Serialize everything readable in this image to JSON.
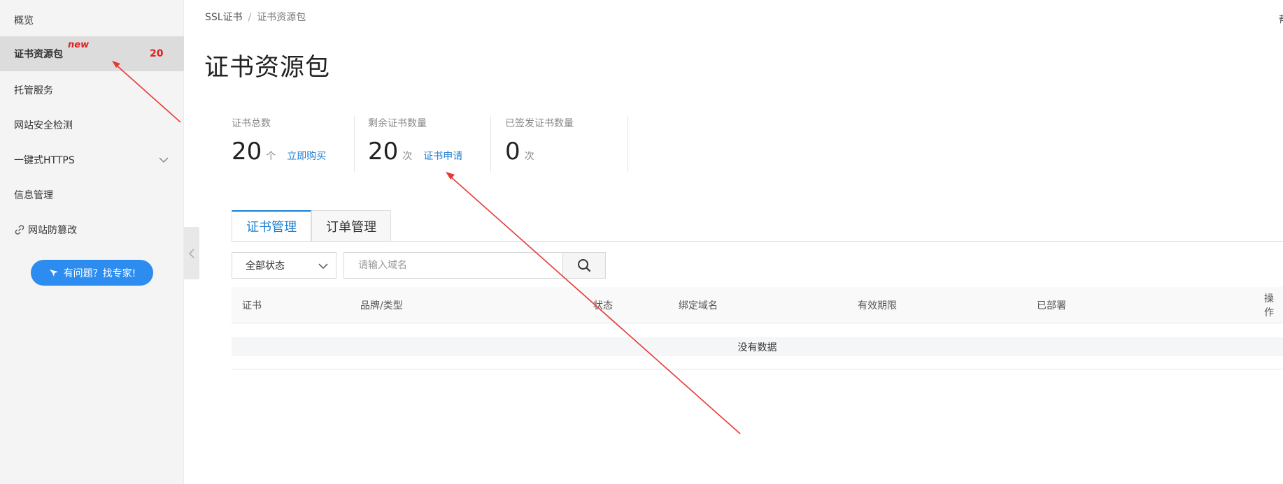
{
  "sidebar": {
    "items": [
      {
        "label": "概览"
      },
      {
        "label": "证书资源包",
        "badge": "new",
        "count": "20"
      },
      {
        "label": "托管服务"
      },
      {
        "label": "网站安全检测"
      },
      {
        "label": "一键式HTTPS"
      },
      {
        "label": "信息管理"
      },
      {
        "label": "网站防篡改"
      }
    ],
    "help_button": "有问题？找专家!"
  },
  "breadcrumb": {
    "root": "SSL证书",
    "separator": "/",
    "current": "证书资源包"
  },
  "page_title": "证书资源包",
  "stats": [
    {
      "label": "证书总数",
      "value": "20",
      "unit": "个",
      "action": "立即购买"
    },
    {
      "label": "剩余证书数量",
      "value": "20",
      "unit": "次",
      "action": "证书申请"
    },
    {
      "label": "已签发证书数量",
      "value": "0",
      "unit": "次"
    }
  ],
  "tabs": [
    {
      "label": "证书管理",
      "active": true
    },
    {
      "label": "订单管理",
      "active": false
    }
  ],
  "filters": {
    "status_selected": "全部状态",
    "search_placeholder": "请输入域名"
  },
  "table": {
    "columns": [
      "证书",
      "品牌/类型",
      "状态",
      "绑定域名",
      "有效期限",
      "已部署",
      "操作"
    ],
    "empty_text": "没有数据"
  },
  "top_right_text": "帮",
  "colors": {
    "accent": "#1a7fd4",
    "help_button": "#2d8cf0",
    "annotation_arrow": "#e53935",
    "badge_red": "#e02020"
  }
}
